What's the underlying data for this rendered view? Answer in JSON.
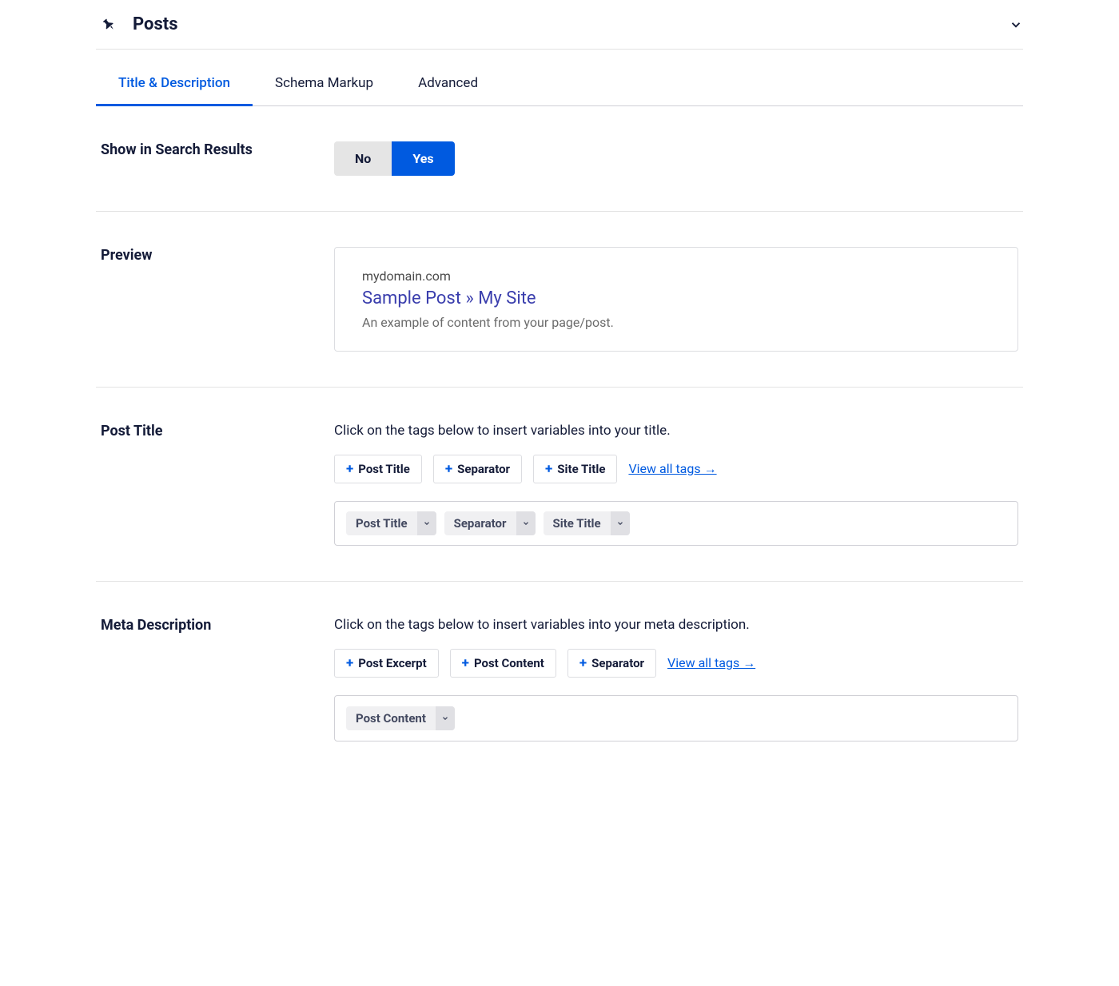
{
  "header": {
    "title": "Posts"
  },
  "tabs": [
    {
      "label": "Title & Description",
      "active": true
    },
    {
      "label": "Schema Markup",
      "active": false
    },
    {
      "label": "Advanced",
      "active": false
    }
  ],
  "show_in_search": {
    "label": "Show in Search Results",
    "options": {
      "no": "No",
      "yes": "Yes"
    },
    "value": "yes"
  },
  "preview": {
    "label": "Preview",
    "domain": "mydomain.com",
    "title": "Sample Post » My Site",
    "description": "An example of content from your page/post."
  },
  "post_title": {
    "label": "Post Title",
    "help": "Click on the tags below to insert variables into your title.",
    "tags": [
      "Post Title",
      "Separator",
      "Site Title"
    ],
    "view_all": "View all tags →",
    "value_chips": [
      "Post Title",
      "Separator",
      "Site Title"
    ]
  },
  "meta_description": {
    "label": "Meta Description",
    "help": "Click on the tags below to insert variables into your meta description.",
    "tags": [
      "Post Excerpt",
      "Post Content",
      "Separator"
    ],
    "view_all": "View all tags →",
    "value_chips": [
      "Post Content"
    ]
  }
}
